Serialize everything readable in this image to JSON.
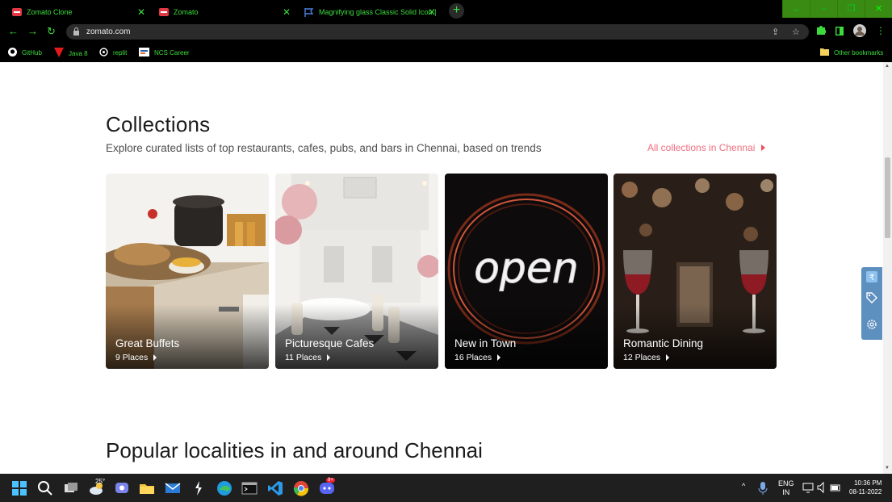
{
  "browser": {
    "tabs": [
      {
        "label": "Zomato Clone"
      },
      {
        "label": "Zomato"
      },
      {
        "label": "Magnifying glass Classic Solid Icon |"
      }
    ],
    "url": "zomato.com",
    "bookmarks": [
      {
        "label": "GitHub"
      },
      {
        "label": "Java 8"
      },
      {
        "label": "replit"
      },
      {
        "label": "NCS Career"
      }
    ],
    "other_bookmarks": "Other bookmarks"
  },
  "collections": {
    "title": "Collections",
    "subtitle": "Explore curated lists of top restaurants, cafes, pubs, and bars in Chennai, based on trends",
    "all_link": "All collections in Chennai",
    "cards": [
      {
        "title": "Great Buffets",
        "places": "9 Places"
      },
      {
        "title": "Picturesque Cafes",
        "places": "11 Places"
      },
      {
        "title": "New in Town",
        "places": "16 Places"
      },
      {
        "title": "Romantic Dining",
        "places": "12 Places"
      }
    ]
  },
  "localities": {
    "title_prefix": "Popular localities in and around ",
    "title_city": "Chennai"
  },
  "open_sign_text": "open",
  "taskbar": {
    "weather_temp": "25°",
    "discord_badge": "9+",
    "lang_top": "ENG",
    "lang_bottom": "IN",
    "time": "10:36 PM",
    "date": "08-11-2022"
  },
  "colors": {
    "accent": "#ef4f5f",
    "browser_green": "#3cdc3c",
    "side_panel": "#5d8fbf"
  }
}
